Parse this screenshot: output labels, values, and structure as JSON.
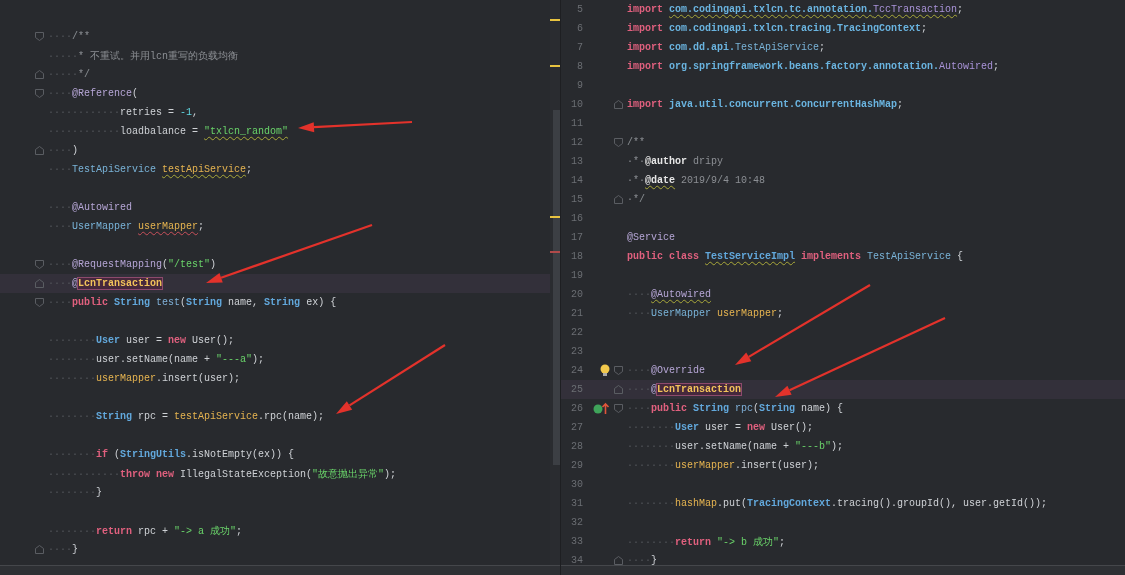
{
  "left_editor": {
    "lines": [
      {
        "kind": "blank"
      },
      {
        "kind": "code",
        "fold_open": true,
        "tokens": [
          {
            "kind": "whitespace",
            "text": "····"
          },
          {
            "kind": "comment",
            "text": "/**"
          }
        ]
      },
      {
        "kind": "code",
        "tokens": [
          {
            "kind": "whitespace",
            "text": "·····"
          },
          {
            "kind": "comment",
            "text": "* 不重试。并用lcn重写的负载均衡"
          }
        ]
      },
      {
        "kind": "code",
        "fold_close": true,
        "tokens": [
          {
            "kind": "whitespace",
            "text": "·····"
          },
          {
            "kind": "comment",
            "text": "*/"
          }
        ]
      },
      {
        "kind": "code",
        "fold_open": true,
        "tokens": [
          {
            "kind": "whitespace",
            "text": "····"
          },
          {
            "kind": "annotation",
            "text": "@Reference"
          },
          {
            "kind": "plain",
            "text": "("
          }
        ]
      },
      {
        "kind": "code",
        "tokens": [
          {
            "kind": "whitespace",
            "text": "············"
          },
          {
            "kind": "plain",
            "text": "retries = "
          },
          {
            "kind": "number",
            "text": "-1"
          },
          {
            "kind": "plain",
            "text": ","
          }
        ]
      },
      {
        "kind": "code",
        "tokens": [
          {
            "kind": "whitespace",
            "text": "············"
          },
          {
            "kind": "plain",
            "text": "loadbalance = "
          },
          {
            "kind": "string",
            "text": "\"txlcn_random\"",
            "warning": true
          }
        ]
      },
      {
        "kind": "code",
        "fold_close": true,
        "tokens": [
          {
            "kind": "whitespace",
            "text": "····"
          },
          {
            "kind": "plain",
            "text": ")"
          }
        ]
      },
      {
        "kind": "code",
        "tokens": [
          {
            "kind": "whitespace",
            "text": "····"
          },
          {
            "kind": "class",
            "text": "TestApiService "
          },
          {
            "kind": "field",
            "text": "testApiService",
            "warning": true
          },
          {
            "kind": "plain",
            "text": ";"
          }
        ]
      },
      {
        "kind": "blank"
      },
      {
        "kind": "code",
        "tokens": [
          {
            "kind": "whitespace",
            "text": "····"
          },
          {
            "kind": "annotation",
            "text": "@Autowired"
          }
        ]
      },
      {
        "kind": "code",
        "tokens": [
          {
            "kind": "whitespace",
            "text": "····"
          },
          {
            "kind": "class",
            "text": "UserMapper "
          },
          {
            "kind": "field",
            "text": "userMapper",
            "error": true
          },
          {
            "kind": "plain",
            "text": ";"
          }
        ]
      },
      {
        "kind": "blank"
      },
      {
        "kind": "code",
        "fold_open": true,
        "tokens": [
          {
            "kind": "whitespace",
            "text": "····"
          },
          {
            "kind": "annotation",
            "text": "@RequestMapping"
          },
          {
            "kind": "plain",
            "text": "("
          },
          {
            "kind": "string",
            "text": "\"/test\""
          },
          {
            "kind": "plain",
            "text": ")"
          }
        ]
      },
      {
        "kind": "code",
        "highlighted": true,
        "fold_close": true,
        "tokens": [
          {
            "kind": "whitespace",
            "text": "····"
          },
          {
            "kind": "annotation",
            "text": "@"
          },
          {
            "kind": "annotation",
            "text": "LcnTransaction",
            "boxed": true
          }
        ]
      },
      {
        "kind": "code",
        "fold_open": true,
        "tokens": [
          {
            "kind": "whitespace",
            "text": "····"
          },
          {
            "kind": "keyword",
            "text": "public"
          },
          {
            "kind": "type",
            "text": " String"
          },
          {
            "kind": "method",
            "text": " test"
          },
          {
            "kind": "plain",
            "text": "("
          },
          {
            "kind": "type",
            "text": "String"
          },
          {
            "kind": "plain",
            "text": " name, "
          },
          {
            "kind": "type",
            "text": "String"
          },
          {
            "kind": "plain",
            "text": " ex) {"
          }
        ]
      },
      {
        "kind": "blank"
      },
      {
        "kind": "code",
        "tokens": [
          {
            "kind": "whitespace",
            "text": "········"
          },
          {
            "kind": "type",
            "text": "User"
          },
          {
            "kind": "plain",
            "text": " user = "
          },
          {
            "kind": "keyword",
            "text": "new"
          },
          {
            "kind": "plain",
            "text": " User();"
          }
        ]
      },
      {
        "kind": "code",
        "tokens": [
          {
            "kind": "whitespace",
            "text": "········"
          },
          {
            "kind": "plain",
            "text": "user.setName(name + "
          },
          {
            "kind": "string",
            "text": "\"---a\""
          },
          {
            "kind": "plain",
            "text": ");"
          }
        ]
      },
      {
        "kind": "code",
        "tokens": [
          {
            "kind": "whitespace",
            "text": "········"
          },
          {
            "kind": "field",
            "text": "userMapper"
          },
          {
            "kind": "plain",
            "text": ".insert(user);"
          }
        ]
      },
      {
        "kind": "blank"
      },
      {
        "kind": "code",
        "tokens": [
          {
            "kind": "whitespace",
            "text": "········"
          },
          {
            "kind": "type",
            "text": "String"
          },
          {
            "kind": "plain",
            "text": " rpc = "
          },
          {
            "kind": "field",
            "text": "testApiService"
          },
          {
            "kind": "plain",
            "text": ".rpc(name);"
          }
        ]
      },
      {
        "kind": "blank"
      },
      {
        "kind": "code",
        "tokens": [
          {
            "kind": "whitespace",
            "text": "········"
          },
          {
            "kind": "keyword",
            "text": "if"
          },
          {
            "kind": "plain",
            "text": " ("
          },
          {
            "kind": "type",
            "text": "StringUtils"
          },
          {
            "kind": "plain",
            "text": ".isNotEmpty(ex)) {"
          }
        ]
      },
      {
        "kind": "code",
        "tokens": [
          {
            "kind": "whitespace",
            "text": "············"
          },
          {
            "kind": "keyword",
            "text": "throw new"
          },
          {
            "kind": "plain",
            "text": " IllegalStateException("
          },
          {
            "kind": "string",
            "text": "\"故意抛出异常\""
          },
          {
            "kind": "plain",
            "text": ");"
          }
        ]
      },
      {
        "kind": "code",
        "tokens": [
          {
            "kind": "whitespace",
            "text": "········"
          },
          {
            "kind": "plain",
            "text": "}"
          }
        ]
      },
      {
        "kind": "blank"
      },
      {
        "kind": "code",
        "tokens": [
          {
            "kind": "whitespace",
            "text": "········"
          },
          {
            "kind": "keyword",
            "text": "return"
          },
          {
            "kind": "plain",
            "text": " rpc + "
          },
          {
            "kind": "string",
            "text": "\"-> a 成功\""
          },
          {
            "kind": "plain",
            "text": ";"
          }
        ]
      },
      {
        "kind": "code",
        "fold_close": true,
        "tokens": [
          {
            "kind": "whitespace",
            "text": "····"
          },
          {
            "kind": "plain",
            "text": "}"
          }
        ]
      }
    ]
  },
  "right_editor": {
    "lines": [
      {
        "number": "5",
        "tokens": [
          {
            "kind": "keyword",
            "text": "import "
          },
          {
            "kind": "package",
            "text": "com.codingapi.txlcn.tc.annotation.",
            "warning": true
          },
          {
            "kind": "import_class",
            "text": "TccTransaction",
            "warning": true
          },
          {
            "kind": "plain",
            "text": ";"
          }
        ]
      },
      {
        "number": "6",
        "tokens": [
          {
            "kind": "keyword",
            "text": "import "
          },
          {
            "kind": "package",
            "text": "com.codingapi.txlcn.tracing.TracingContext"
          },
          {
            "kind": "plain",
            "text": ";"
          }
        ]
      },
      {
        "number": "7",
        "tokens": [
          {
            "kind": "keyword",
            "text": "import "
          },
          {
            "kind": "package",
            "text": "com.dd.api."
          },
          {
            "kind": "class",
            "text": "TestApiService"
          },
          {
            "kind": "plain",
            "text": ";"
          }
        ]
      },
      {
        "number": "8",
        "tokens": [
          {
            "kind": "keyword",
            "text": "import "
          },
          {
            "kind": "package",
            "text": "org.springframework.beans.factory.annotation."
          },
          {
            "kind": "import_class",
            "text": "Autowired"
          },
          {
            "kind": "plain",
            "text": ";"
          }
        ]
      },
      {
        "number": "9"
      },
      {
        "number": "10",
        "fold_close": true,
        "tokens": [
          {
            "kind": "keyword",
            "text": "import "
          },
          {
            "kind": "package",
            "text": "java.util.concurrent.ConcurrentHashMap"
          },
          {
            "kind": "plain",
            "text": ";"
          }
        ]
      },
      {
        "number": "11"
      },
      {
        "number": "12",
        "fold_open": true,
        "tokens": [
          {
            "kind": "comment",
            "text": "/**"
          }
        ]
      },
      {
        "number": "13",
        "tokens": [
          {
            "kind": "comment",
            "text": "·*·"
          },
          {
            "kind": "doctag",
            "text": "@author"
          },
          {
            "kind": "comment",
            "text": " dripy"
          }
        ]
      },
      {
        "number": "14",
        "tokens": [
          {
            "kind": "comment",
            "text": "·*·"
          },
          {
            "kind": "doctag",
            "text": "@date",
            "warning": true
          },
          {
            "kind": "comment",
            "text": " 2019/9/4 10:48"
          }
        ]
      },
      {
        "number": "15",
        "fold_close": true,
        "tokens": [
          {
            "kind": "comment",
            "text": "·*/"
          }
        ]
      },
      {
        "number": "16"
      },
      {
        "number": "17",
        "tokens": [
          {
            "kind": "annotation",
            "text": "@Service"
          }
        ]
      },
      {
        "number": "18",
        "tokens": [
          {
            "kind": "keyword",
            "text": "public class "
          },
          {
            "kind": "type",
            "text": "TestServiceImpl",
            "warning": true
          },
          {
            "kind": "keyword",
            "text": " implements "
          },
          {
            "kind": "class",
            "text": "TestApiService"
          },
          {
            "kind": "plain",
            "text": " {"
          }
        ]
      },
      {
        "number": "19"
      },
      {
        "number": "20",
        "tokens": [
          {
            "kind": "whitespace",
            "text": "····"
          },
          {
            "kind": "annotation",
            "text": "@Autowired",
            "warning": true
          }
        ]
      },
      {
        "number": "21",
        "tokens": [
          {
            "kind": "whitespace",
            "text": "····"
          },
          {
            "kind": "class",
            "text": "UserMapper "
          },
          {
            "kind": "field",
            "text": "userMapper"
          },
          {
            "kind": "plain",
            "text": ";"
          }
        ]
      },
      {
        "number": "22"
      },
      {
        "number": "23"
      },
      {
        "number": "24",
        "bulb": true,
        "fold_open": true,
        "tokens": [
          {
            "kind": "whitespace",
            "text": "····"
          },
          {
            "kind": "annotation",
            "text": "@Override"
          }
        ]
      },
      {
        "number": "25",
        "highlighted": true,
        "fold_close": true,
        "tokens": [
          {
            "kind": "whitespace",
            "text": "····"
          },
          {
            "kind": "annotation",
            "text": "@"
          },
          {
            "kind": "annotation",
            "text": "LcnTransaction",
            "boxed": true
          }
        ]
      },
      {
        "number": "26",
        "override_marker": true,
        "fold_open": true,
        "tokens": [
          {
            "kind": "whitespace",
            "text": "····"
          },
          {
            "kind": "keyword",
            "text": "public"
          },
          {
            "kind": "type",
            "text": " String"
          },
          {
            "kind": "method",
            "text": " rpc"
          },
          {
            "kind": "plain",
            "text": "("
          },
          {
            "kind": "type",
            "text": "String"
          },
          {
            "kind": "plain",
            "text": " name) {"
          }
        ]
      },
      {
        "number": "27",
        "tokens": [
          {
            "kind": "whitespace",
            "text": "········"
          },
          {
            "kind": "type",
            "text": "User"
          },
          {
            "kind": "plain",
            "text": " user = "
          },
          {
            "kind": "keyword",
            "text": "new"
          },
          {
            "kind": "plain",
            "text": " User();"
          }
        ]
      },
      {
        "number": "28",
        "tokens": [
          {
            "kind": "whitespace",
            "text": "········"
          },
          {
            "kind": "plain",
            "text": "user.setName(name + "
          },
          {
            "kind": "string",
            "text": "\"---b\""
          },
          {
            "kind": "plain",
            "text": ");"
          }
        ]
      },
      {
        "number": "29",
        "tokens": [
          {
            "kind": "whitespace",
            "text": "········"
          },
          {
            "kind": "field",
            "text": "userMapper"
          },
          {
            "kind": "plain",
            "text": ".insert(user);"
          }
        ]
      },
      {
        "number": "30"
      },
      {
        "number": "31",
        "tokens": [
          {
            "kind": "whitespace",
            "text": "········"
          },
          {
            "kind": "field",
            "text": "hashMap"
          },
          {
            "kind": "plain",
            "text": ".put("
          },
          {
            "kind": "type",
            "text": "TracingContext"
          },
          {
            "kind": "plain",
            "text": ".tracing().groupId(), user.getId());"
          }
        ]
      },
      {
        "number": "32"
      },
      {
        "number": "33",
        "tokens": [
          {
            "kind": "whitespace",
            "text": "········"
          },
          {
            "kind": "keyword",
            "text": "return"
          },
          {
            "kind": "string",
            "text": " \"-> b 成功\""
          },
          {
            "kind": "plain",
            "text": ";"
          }
        ]
      },
      {
        "number": "34",
        "fold_close": true,
        "tokens": [
          {
            "kind": "whitespace",
            "text": "····"
          },
          {
            "kind": "plain",
            "text": "}"
          }
        ]
      }
    ]
  }
}
